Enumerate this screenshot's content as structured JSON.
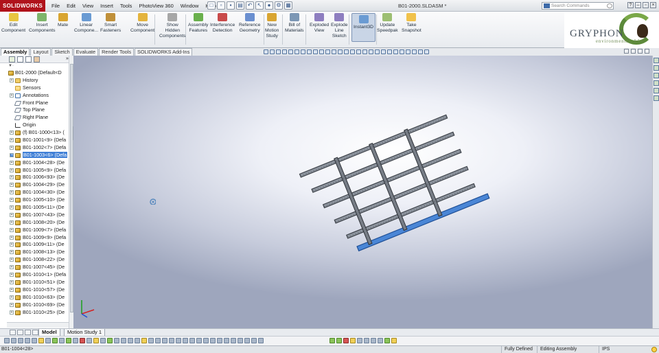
{
  "app": {
    "logo": "SOLIDWORKS",
    "document_title": "B01-2000.SLDASM *",
    "search_placeholder": "Search Commands",
    "menus": [
      "File",
      "Edit",
      "View",
      "Insert",
      "Tools",
      "PhotoView 360",
      "Window",
      "Help"
    ]
  },
  "commands": [
    {
      "line1": "Edit",
      "line2": "Component",
      "line3": ""
    },
    {
      "line1": "Insert",
      "line2": "Components",
      "line3": ""
    },
    {
      "line1": "Mate",
      "line2": "",
      "line3": ""
    },
    {
      "line1": "Linear",
      "line2": "Compone...",
      "line3": ""
    },
    {
      "line1": "Smart",
      "line2": "Fasteners",
      "line3": ""
    },
    {
      "line1": "Move",
      "line2": "Component",
      "line3": ""
    },
    {
      "line1": "Show",
      "line2": "Hidden",
      "line3": "Components"
    },
    {
      "line1": "Assembly",
      "line2": "Features",
      "line3": ""
    },
    {
      "line1": "Interference",
      "line2": "Detection",
      "line3": ""
    },
    {
      "line1": "Reference",
      "line2": "Geometry",
      "line3": ""
    },
    {
      "line1": "New",
      "line2": "Motion",
      "line3": "Study"
    },
    {
      "line1": "Bill of",
      "line2": "Materials",
      "line3": ""
    },
    {
      "line1": "Exploded",
      "line2": "View",
      "line3": ""
    },
    {
      "line1": "Explode",
      "line2": "Line",
      "line3": "Sketch"
    },
    {
      "line1": "Instant3D",
      "line2": "",
      "line3": ""
    },
    {
      "line1": "Update",
      "line2": "Speedpak",
      "line3": ""
    },
    {
      "line1": "Take",
      "line2": "Snapshot",
      "line3": ""
    }
  ],
  "brand": {
    "name": "GRYPHON",
    "subtitle": "environmental, LLC"
  },
  "tabs": [
    "Assembly",
    "Layout",
    "Sketch",
    "Evaluate",
    "Render Tools",
    "SOLIDWORKS Add-Ins"
  ],
  "tree": {
    "root": "B01-2000  (Default<D",
    "items": [
      {
        "label": "History",
        "icon": "folder"
      },
      {
        "label": "Sensors",
        "icon": "sens"
      },
      {
        "label": "Annotations",
        "icon": "ann"
      },
      {
        "label": "Front Plane",
        "icon": "plane"
      },
      {
        "label": "Top Plane",
        "icon": "plane"
      },
      {
        "label": "Right Plane",
        "icon": "plane"
      },
      {
        "label": "Origin",
        "icon": "org"
      },
      {
        "label": "(f) B01-1000<13> (",
        "icon": "part"
      },
      {
        "label": "B01-1001<9> (Defa",
        "icon": "part"
      },
      {
        "label": "B01-1002<7> (Defa",
        "icon": "part"
      },
      {
        "label": "B01-1003<6> (Defa",
        "icon": "part",
        "selected": true
      },
      {
        "label": "B01-1004<28> (De",
        "icon": "part"
      },
      {
        "label": "B01-1005<9> (Defa",
        "icon": "part"
      },
      {
        "label": "B01-1006<93> (De",
        "icon": "part"
      },
      {
        "label": "B01-1004<29> (De",
        "icon": "part"
      },
      {
        "label": "B01-1004<30> (De",
        "icon": "part"
      },
      {
        "label": "B01-1005<10> (De",
        "icon": "part"
      },
      {
        "label": "B01-1005<11> (De",
        "icon": "part"
      },
      {
        "label": "B01-1007<43> (De",
        "icon": "part"
      },
      {
        "label": "B01-1008<20> (De",
        "icon": "part"
      },
      {
        "label": "B01-1009<7> (Defa",
        "icon": "part"
      },
      {
        "label": "B01-1009<9> (Defa",
        "icon": "part"
      },
      {
        "label": "B01-1009<11> (De",
        "icon": "part"
      },
      {
        "label": "B01-1008<13> (De",
        "icon": "part"
      },
      {
        "label": "B01-1008<22> (De",
        "icon": "part"
      },
      {
        "label": "B01-1007<45> (De",
        "icon": "part"
      },
      {
        "label": "B01-1010<1> (Defa",
        "icon": "part"
      },
      {
        "label": "B01-1010<51> (De",
        "icon": "part"
      },
      {
        "label": "B01-1010<57> (De",
        "icon": "part"
      },
      {
        "label": "B01-1010<63> (De",
        "icon": "part"
      },
      {
        "label": "B01-1010<69> (De",
        "icon": "part"
      },
      {
        "label": "B01-1010<25> (De",
        "icon": "part"
      }
    ]
  },
  "bottom_tabs": [
    "Model",
    "Motion Study 1"
  ],
  "status": {
    "selection": "B01-1004<28>",
    "definition": "Fully Defined",
    "mode": "Editing Assembly",
    "units": "IPS"
  },
  "colors": {
    "accent": "#b0121b",
    "selection": "#3f7fd6",
    "highlight_part": "#4a86d6"
  }
}
